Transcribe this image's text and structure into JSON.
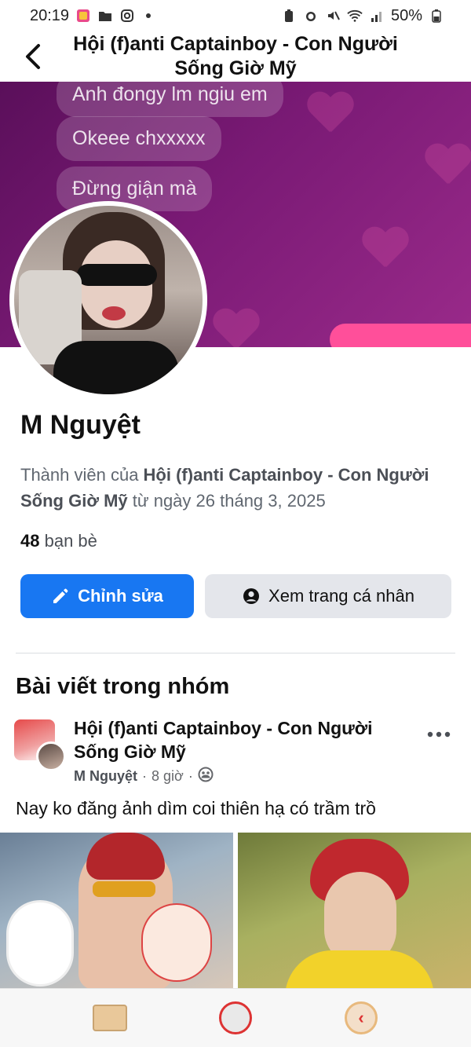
{
  "status_bar": {
    "time": "20:19",
    "battery": "50%"
  },
  "header": {
    "back_icon": "back-arrow-icon",
    "title": "Hội (f)anti Captainboy - Con Người Sống Giờ Mỹ"
  },
  "cover": {
    "bubbles": [
      "Anh đongy lm ngiu em",
      "Okeee chxxxxx",
      "Đừng giận mà"
    ]
  },
  "profile": {
    "name": "M Nguyệt",
    "member_prefix": "Thành viên của ",
    "group_name": "Hội (f)anti Captainboy - Con Người Sống Giờ Mỹ",
    "member_suffix": " từ ngày 26 tháng 3, 2025",
    "friends_count": "48",
    "friends_label": " bạn bè"
  },
  "actions": {
    "edit_label": "Chỉnh sửa",
    "view_profile_label": "Xem trang cá nhân"
  },
  "posts_section": {
    "title": "Bài viết trong nhóm",
    "post": {
      "group": "Hội (f)anti Captainboy - Con Người Sống Giờ Mỹ",
      "author": "M Nguyệt",
      "time": "8 giờ",
      "separator": "·",
      "text": "Nay ko đăng ảnh dìm coi thiên hạ có trầm trồ"
    }
  },
  "colors": {
    "primary_button": "#1877f2",
    "secondary_button": "#e4e6eb",
    "cover": "#7a1a75"
  }
}
